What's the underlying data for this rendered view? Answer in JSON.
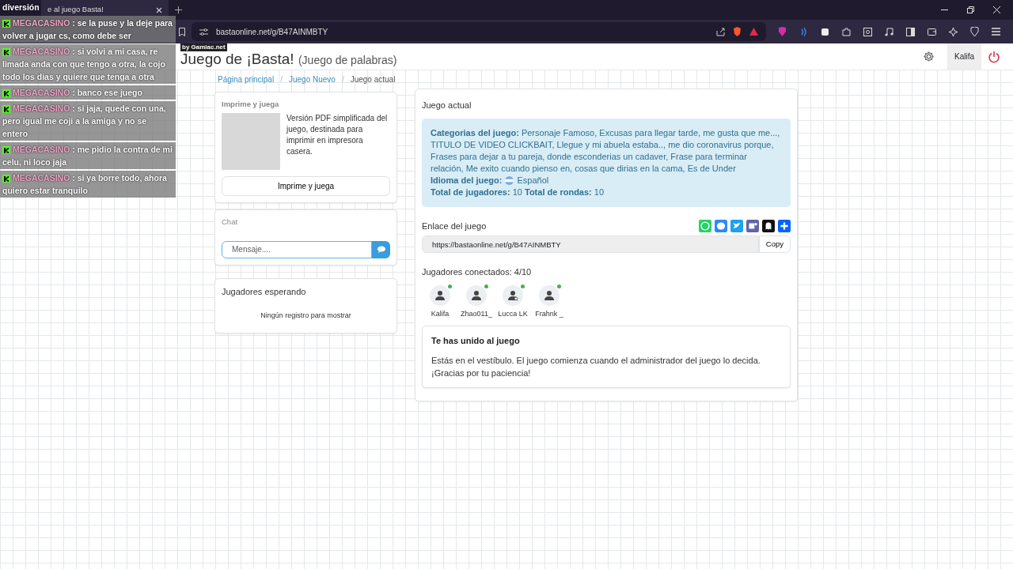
{
  "browser": {
    "tab_title": "e al juego Basta!",
    "address": "bastaonline.net/g/B47AINMBTY"
  },
  "stream_overlay": {
    "credit": "by Gamiac.net",
    "separator": ":",
    "messages": [
      {
        "kind": "continuation",
        "text": "diversión"
      },
      {
        "kind": "message",
        "user": "MEGACASINO",
        "text": "se la puse y la deje para volver a jugar cs, como debe ser"
      },
      {
        "kind": "message",
        "user": "MEGACASINO",
        "text": "si volvi a mi casa, re limada anda con que tengo a otra, la cojo todo los dias y quiere que tenga a otra"
      },
      {
        "kind": "message",
        "user": "MEGACASINO",
        "text": "banco ese juego"
      },
      {
        "kind": "message",
        "user": "MEGACASINO",
        "text": "si jaja, quede con una, pero igual me coji a la amiga y no se entero"
      },
      {
        "kind": "message",
        "user": "MEGACASINO",
        "text": "me pidio la contra de mi celu, ni loco jaja"
      },
      {
        "kind": "message",
        "user": "MEGACASINO",
        "text": "si ya borre todo, ahora quiero estar tranquilo"
      }
    ]
  },
  "header": {
    "title": "Juego de ¡Basta!",
    "subtitle": "(Juego de palabras)",
    "user": "Kalifa"
  },
  "breadcrumb_separator": "/",
  "breadcrumb": [
    {
      "label": "Página principal",
      "current": false
    },
    {
      "label": "Juego Nuevo",
      "current": false
    },
    {
      "label": "Juego actual",
      "current": true
    }
  ],
  "print_card": {
    "heading": "Imprime y juega",
    "description": "Versión PDF simplificada del juego, destinada para imprimir en impresora casera.",
    "button": "Imprime y juega"
  },
  "chat": {
    "heading": "Chat",
    "placeholder": "Mensaje...."
  },
  "waiting": {
    "heading": "Jugadores esperando",
    "empty": "Ningún registro para mostrar"
  },
  "game": {
    "heading": "Juego actual",
    "categories": "**Categorias del juego:** Personaje Famoso, Excusas para llegar tarde, me gusta que me..., TITULO DE VIDEO CLICKBAIT, Llegue y mi abuela estaba.., me dio coronavirus porque, Frases para dejar a tu pareja, donde esconderias un cadaver, Frase para terminar relación, Me exito cuando pienso en, cosas que dirias en la cama, Es de Under",
    "language_label": "Idioma del juego:",
    "language": "Español",
    "totals": "**Total de jugadores:** 10 **Total de rondas:** 10",
    "link_label": "Enlace del juego",
    "link": "https://bastaonline.net/g/B47AINMBTY",
    "copy": "Copy",
    "players_heading": "Jugadores conectados: 4/10",
    "players": [
      {
        "name": "Kalifa",
        "admin": false,
        "online": true
      },
      {
        "name": "Zhao011_",
        "admin": false,
        "online": true
      },
      {
        "name": "Lucca LK",
        "admin": true,
        "online": true
      },
      {
        "name": "Frahnk _",
        "admin": false,
        "online": true
      }
    ],
    "notice_title": "Te has unido al juego",
    "notice_text": "Estás en el vestíbulo. El juego comienza cuando el administrador del juego lo decida. ¡Gracias por tu paciencia!"
  }
}
